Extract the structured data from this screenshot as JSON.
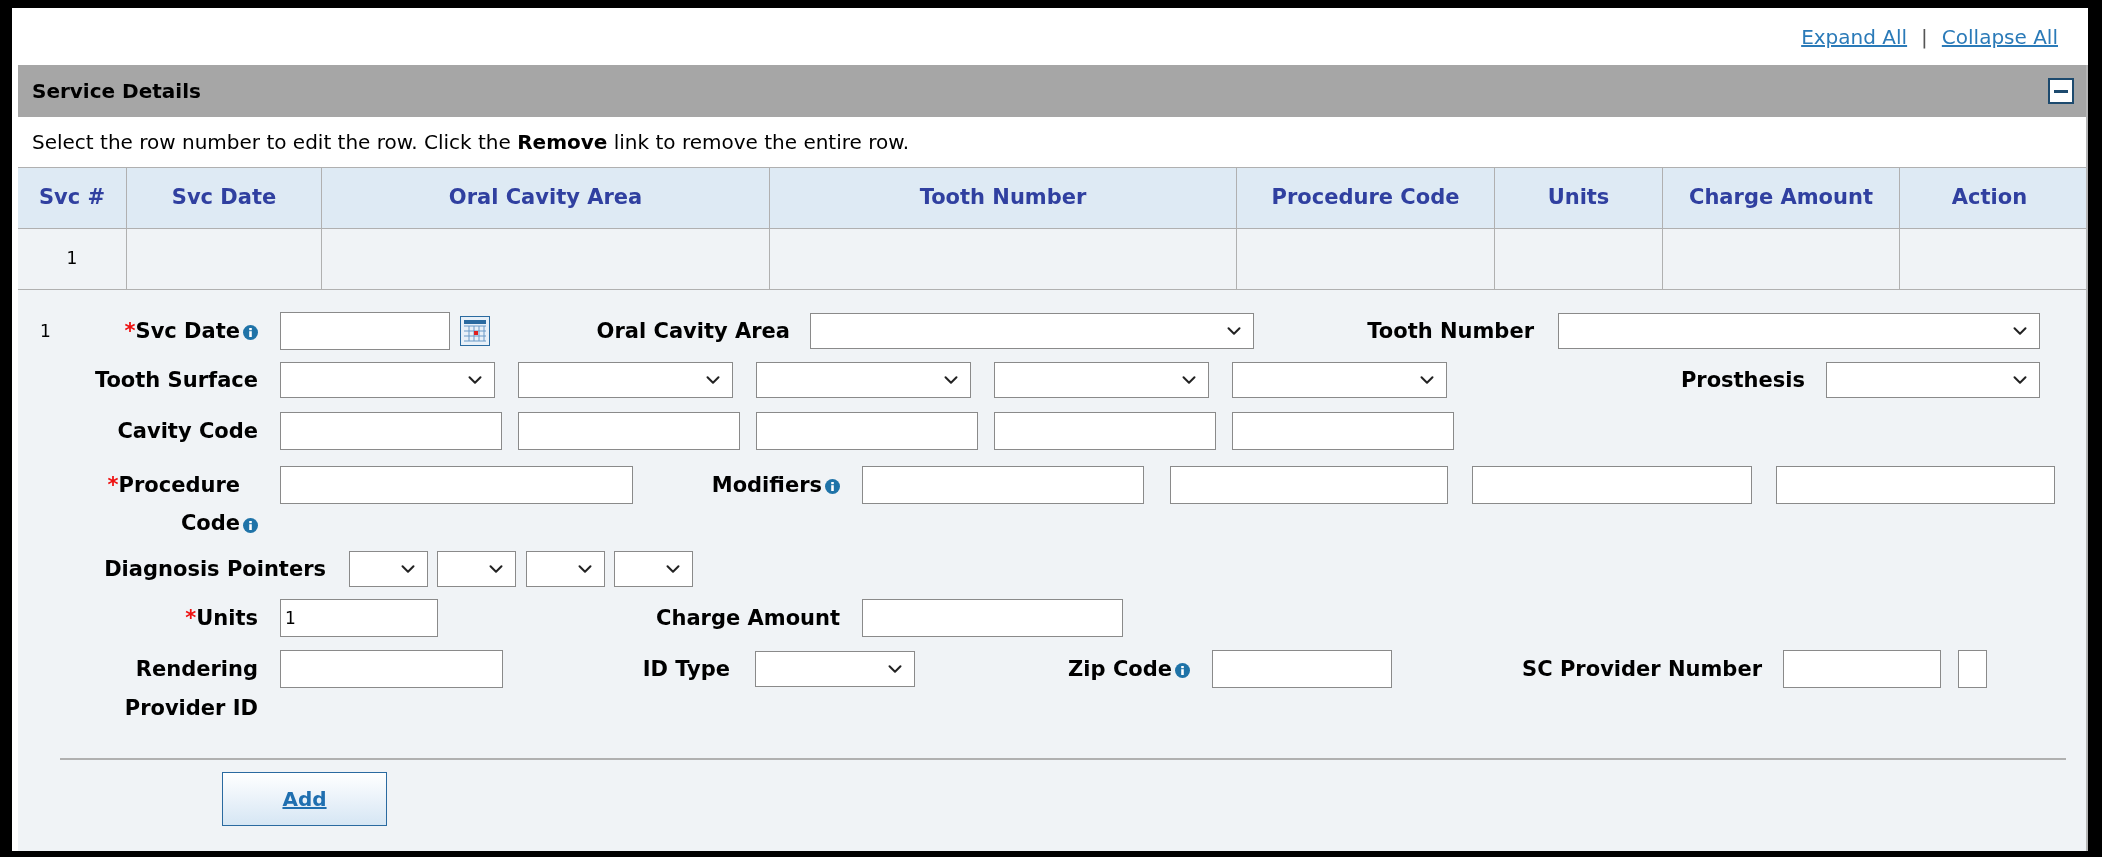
{
  "links": [
    {
      "label": "Expand All"
    },
    {
      "label": "Collapse All"
    }
  ],
  "link_separator": "|",
  "section": {
    "title": "Service Details",
    "expanded": true
  },
  "instructions": "Select the row number to edit the row. Click the **Remove** link to remove the entire row.",
  "table": {
    "columns": [
      "Svc #",
      "Svc Date",
      "Oral Cavity Area",
      "Tooth Number",
      "Procedure Code",
      "Units",
      "Charge Amount",
      "Action"
    ],
    "rows": [
      {
        "svc_no": "1"
      }
    ]
  },
  "form": {
    "row_number": "1",
    "required_marker": "*",
    "fields": {
      "svc_date": {
        "label": "Svc Date",
        "required": true,
        "info": true
      },
      "oral_cavity_area": {
        "label": "Oral Cavity Area",
        "required": false,
        "info": false
      },
      "tooth_number": {
        "label": "Tooth Number",
        "required": false,
        "info": false
      },
      "tooth_surface": {
        "label": "Tooth Surface",
        "required": false,
        "info": false
      },
      "prosthesis": {
        "label": "Prosthesis",
        "required": false,
        "info": false
      },
      "cavity_code": {
        "label": "Cavity Code",
        "required": false,
        "info": false
      },
      "procedure_code": {
        "label": "Procedure Code",
        "required": true,
        "info": true
      },
      "modifiers": {
        "label": "Modifiers",
        "required": false,
        "info": true
      },
      "diagnosis_pointers": {
        "label": "Diagnosis Pointers",
        "required": false,
        "info": false
      },
      "units": {
        "label": "Units",
        "required": true,
        "info": false,
        "value": "1"
      },
      "charge_amount": {
        "label": "Charge Amount",
        "required": false,
        "info": false
      },
      "rendering_provider_id": {
        "label": "Rendering Provider ID",
        "required": false,
        "info": false
      },
      "id_type": {
        "label": "ID Type",
        "required": false,
        "info": false
      },
      "zip_code": {
        "label": "Zip Code",
        "required": false,
        "info": true
      },
      "sc_provider_number": {
        "label": "SC Provider Number",
        "required": false,
        "info": false
      }
    },
    "add_button": "Add"
  }
}
